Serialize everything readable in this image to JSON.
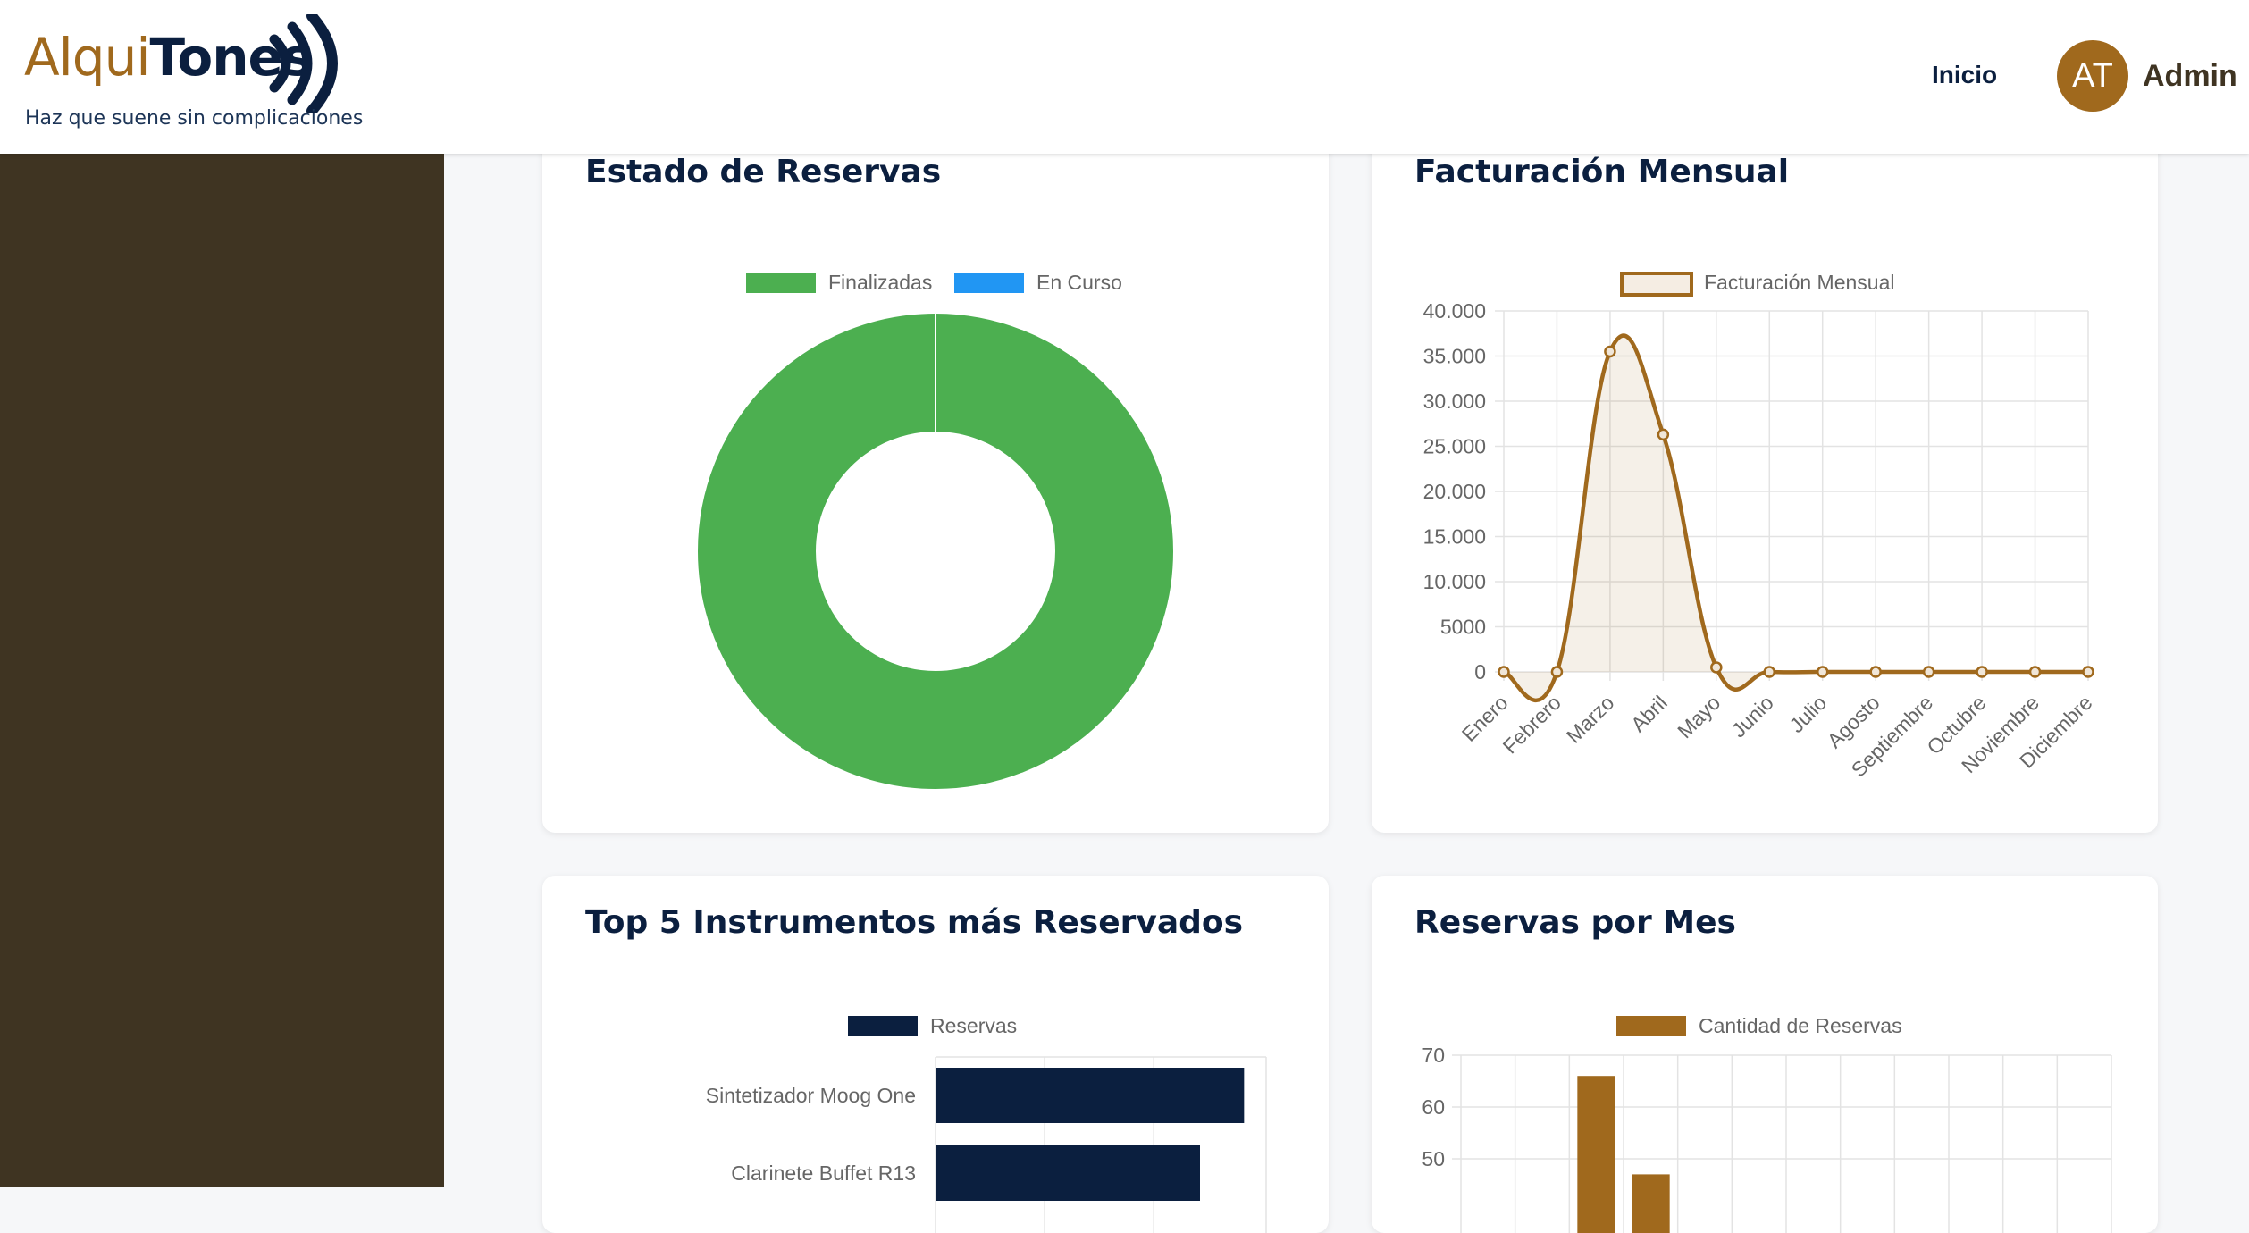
{
  "app": {
    "logo_light": "Alqui",
    "logo_bold": "Tones",
    "tagline": "Haz que suene sin complicaciones"
  },
  "header": {
    "nav_inicio": "Inicio",
    "avatar_initials": "AT",
    "user_name": "Admin"
  },
  "colors": {
    "brand_gold": "#a0691d",
    "navy": "#0b1f3f",
    "sidebar": "#3f3422",
    "green": "#4caf50",
    "blue": "#2196f3"
  },
  "cards": {
    "estado": {
      "title": "Estado de Reservas"
    },
    "facturacion": {
      "title": "Facturación Mensual"
    },
    "top5": {
      "title": "Top 5 Instrumentos más Reservados"
    },
    "reservas_mes": {
      "title": "Reservas por Mes"
    }
  },
  "chart_data": [
    {
      "type": "pie",
      "variant": "doughnut",
      "title": "Estado de Reservas",
      "labels": [
        "Finalizadas",
        "En Curso"
      ],
      "values": [
        100,
        0
      ],
      "colors": [
        "#4caf50",
        "#2196f3"
      ],
      "legend": "top"
    },
    {
      "type": "line",
      "title": "Facturación Mensual",
      "categories": [
        "Enero",
        "Febrero",
        "Marzo",
        "Abril",
        "Mayo",
        "Junio",
        "Julio",
        "Agosto",
        "Septiembre",
        "Octubre",
        "Noviembre",
        "Diciembre"
      ],
      "series": [
        {
          "name": "Facturación Mensual",
          "values": [
            0,
            0,
            35500,
            26300,
            500,
            0,
            0,
            0,
            0,
            0,
            0,
            0
          ]
        }
      ],
      "yticks": [
        "0",
        "5000",
        "10.000",
        "15.000",
        "20.000",
        "25.000",
        "30.000",
        "35.000",
        "40.000"
      ],
      "ylim": [
        0,
        40000
      ],
      "fill": true,
      "grid": true,
      "legend": "top"
    },
    {
      "type": "bar",
      "orientation": "horizontal",
      "title": "Top 5 Instrumentos más Reservados",
      "categories": [
        "Sintetizador Moog One",
        "Clarinete Buffet R13"
      ],
      "series": [
        {
          "name": "Reservas",
          "values": [
            28,
            24
          ]
        }
      ],
      "xlim": [
        0,
        30
      ],
      "grid": true,
      "legend": "top"
    },
    {
      "type": "bar",
      "title": "Reservas por Mes",
      "series": [
        {
          "name": "Cantidad de Reservas",
          "values": [
            0,
            0,
            66,
            47,
            0,
            0,
            0,
            0,
            0,
            0,
            0,
            0
          ]
        }
      ],
      "yticks": [
        "50",
        "60",
        "70"
      ],
      "ylim": [
        0,
        70
      ],
      "grid": true,
      "legend": "top"
    }
  ]
}
